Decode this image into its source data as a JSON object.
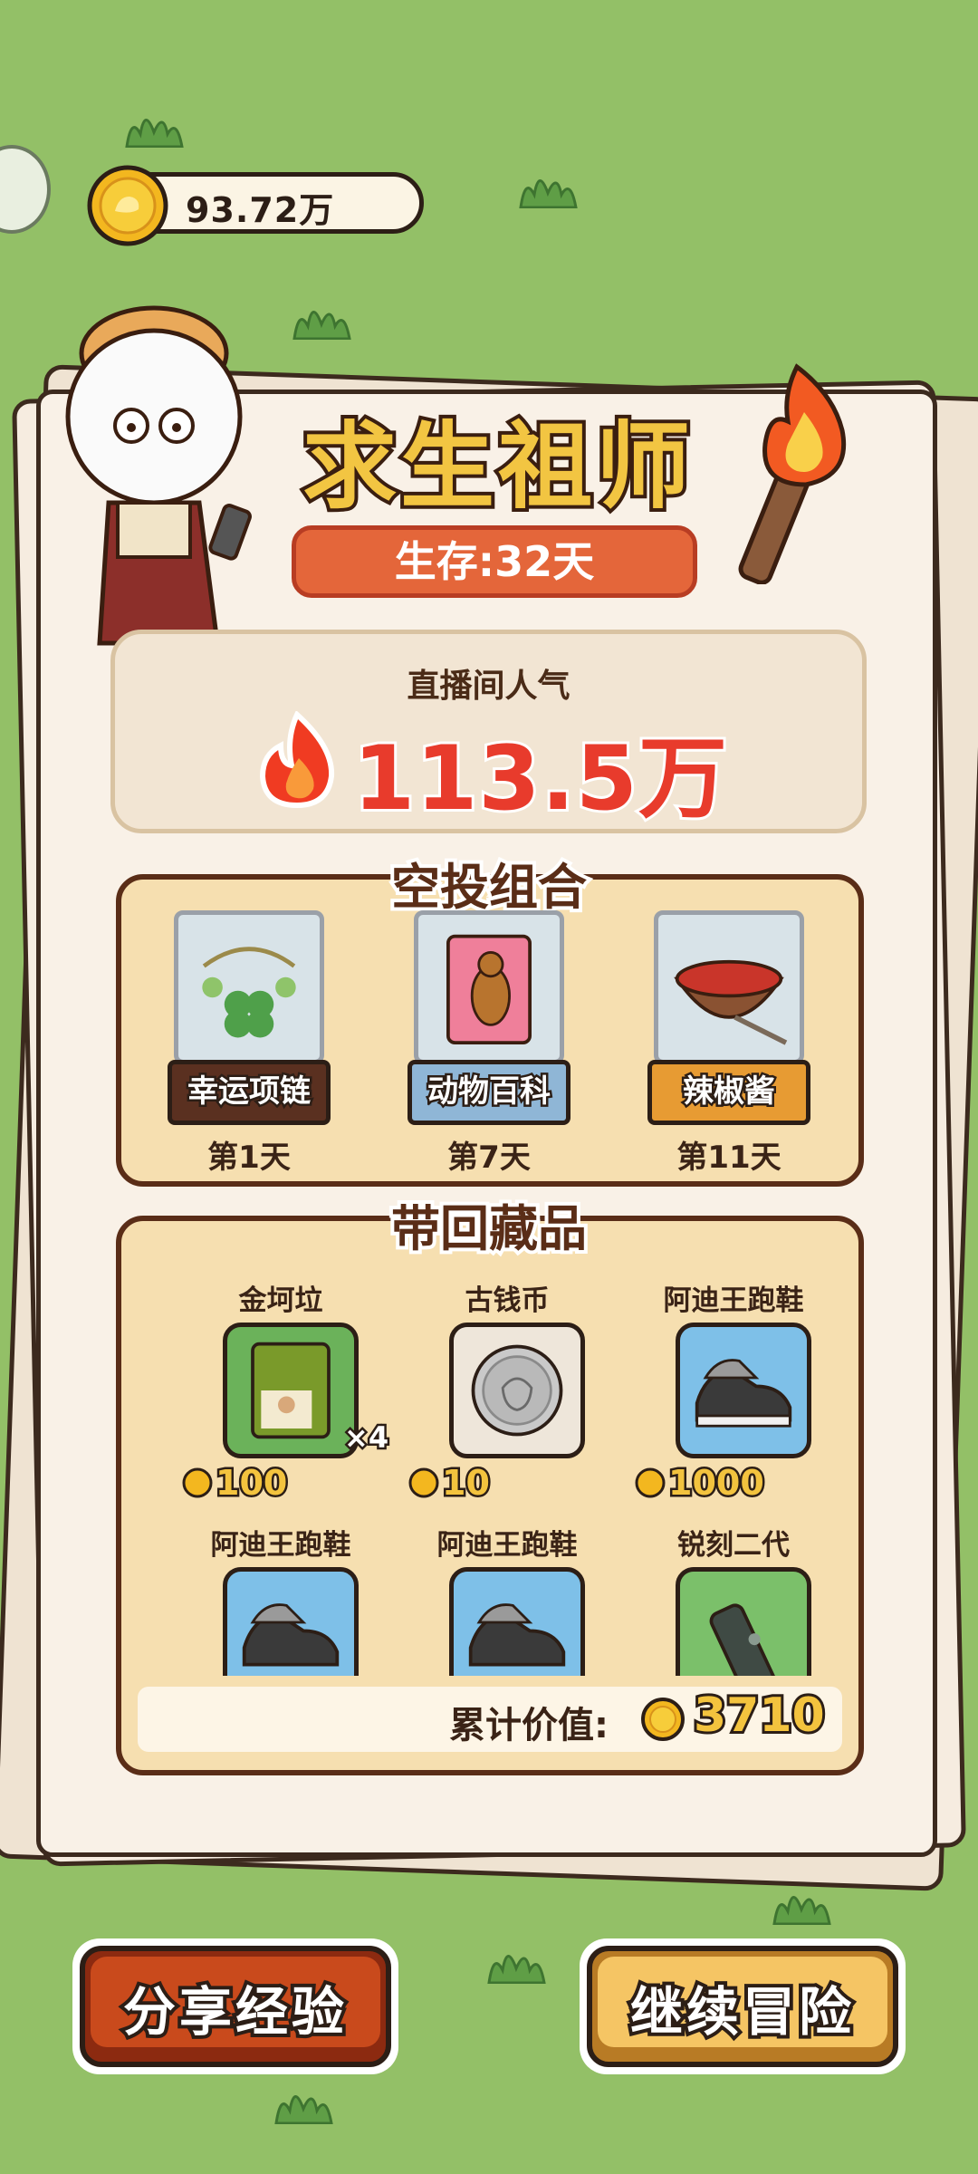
{
  "currency": {
    "amount": "93.72万",
    "icon": "gold-coin-icon"
  },
  "header": {
    "title": "求生祖师",
    "survival_days": "生存:32天"
  },
  "popularity": {
    "label": "直播间人气",
    "value": "113.5万",
    "icon": "flame-icon"
  },
  "airdrop": {
    "title": "空投组合",
    "items": [
      {
        "name": "幸运项链",
        "day": "第1天",
        "icon": "clover-necklace-icon",
        "label_color": "#5a3020"
      },
      {
        "name": "动物百科",
        "day": "第7天",
        "icon": "animal-encyclopedia-icon",
        "label_color": "#8fb6d6"
      },
      {
        "name": "辣椒酱",
        "day": "第11天",
        "icon": "chili-sauce-bowl-icon",
        "label_color": "#e79b33"
      }
    ]
  },
  "collectibles": {
    "title": "带回藏品",
    "items": [
      {
        "name": "金坷垃",
        "price": "100",
        "qty": "×4",
        "icon": "fertilizer-bag-icon",
        "bg": "#6bb25a"
      },
      {
        "name": "古钱币",
        "price": "10",
        "qty": "",
        "icon": "ancient-coin-icon",
        "bg": "#eee6da"
      },
      {
        "name": "阿迪王跑鞋",
        "price": "1000",
        "qty": "",
        "icon": "sneaker-icon",
        "bg": "#7ec0e8"
      },
      {
        "name": "阿迪王跑鞋",
        "price": "",
        "qty": "",
        "icon": "sneaker-icon",
        "bg": "#7ec0e8"
      },
      {
        "name": "阿迪王跑鞋",
        "price": "",
        "qty": "",
        "icon": "sneaker-icon",
        "bg": "#7ec0e8"
      },
      {
        "name": "锐刻二代",
        "price": "",
        "qty": "",
        "icon": "e-cigarette-icon",
        "bg": "#7bc06a"
      }
    ],
    "total_label": "累计价值:",
    "total_value": "3710"
  },
  "buttons": {
    "share": "分享经验",
    "continue": "继续冒险"
  }
}
